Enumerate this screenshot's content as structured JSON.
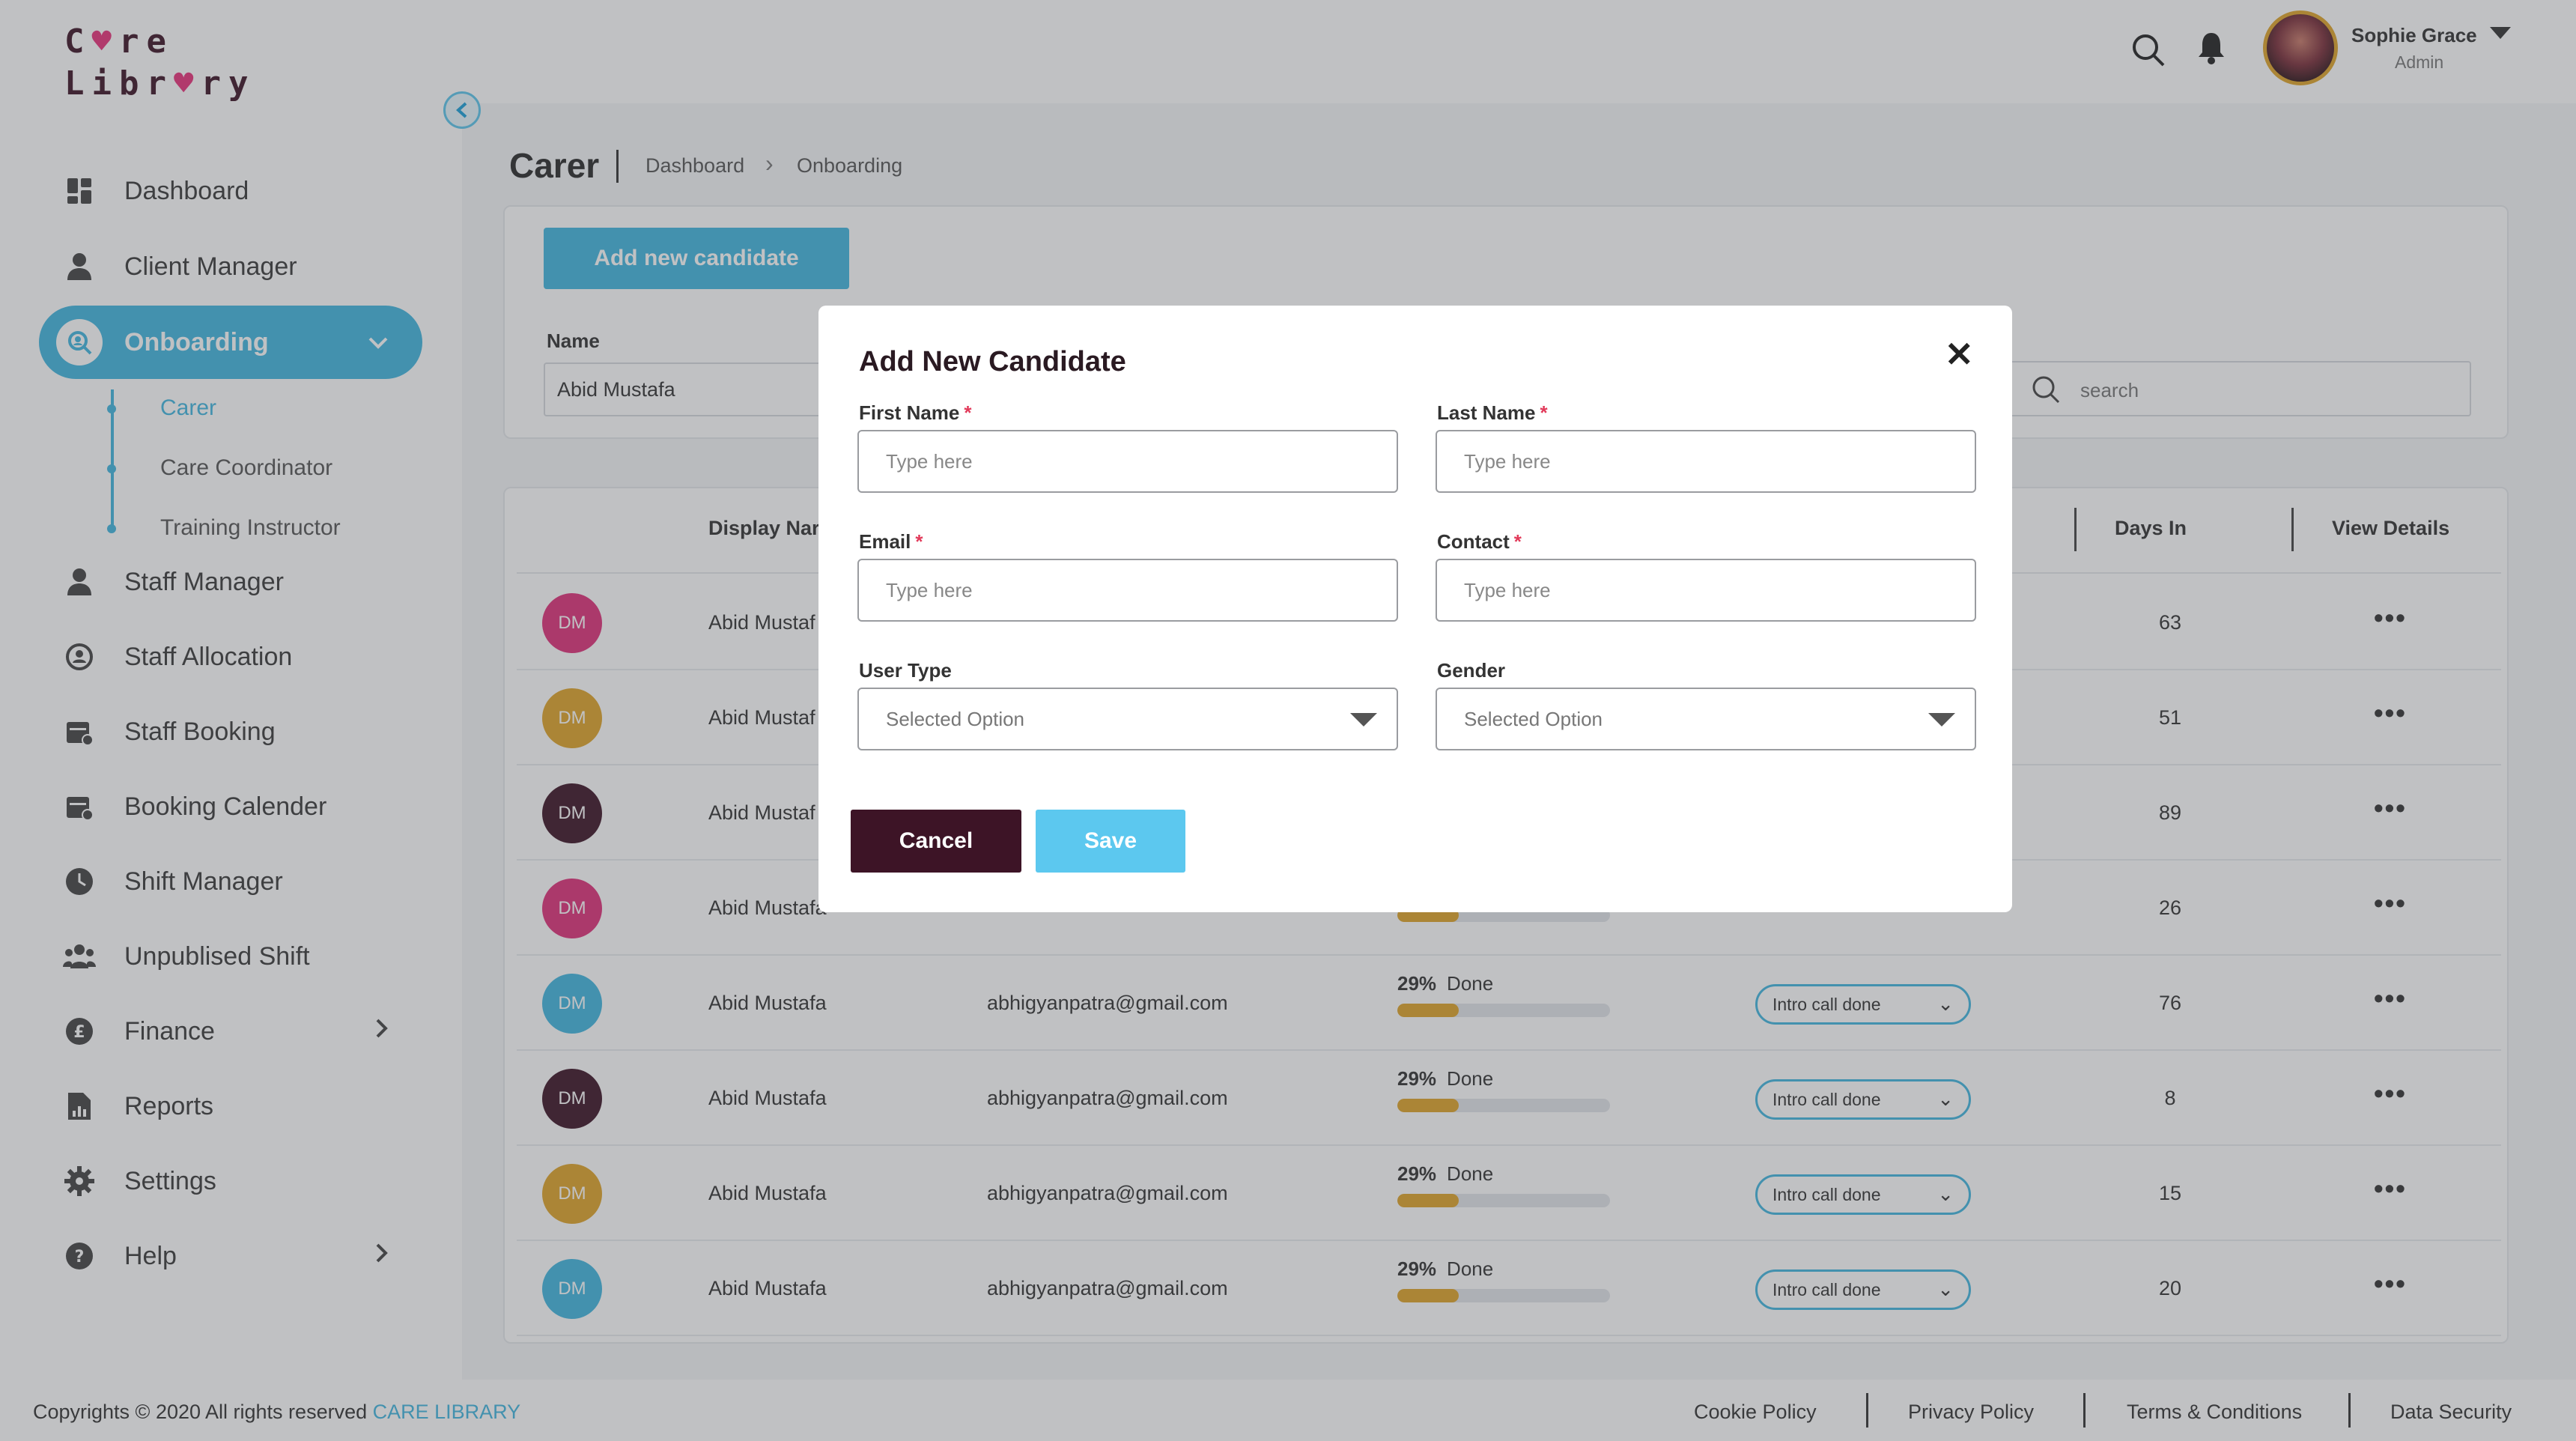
{
  "brand": {
    "logo_line1": "C",
    "logo_line1_rest": "re",
    "logo_line2": "Libr",
    "logo_line2_rest": "ry",
    "heart": "♥"
  },
  "sidebar": {
    "items": [
      {
        "label": "Dashboard",
        "icon": "dashboard-icon"
      },
      {
        "label": "Client Manager",
        "icon": "user-icon"
      },
      {
        "label": "Onboarding",
        "icon": "onboarding-icon"
      },
      {
        "label": "Staff Manager",
        "icon": "user-icon"
      },
      {
        "label": "Staff Allocation",
        "icon": "allocation-icon"
      },
      {
        "label": "Staff Booking",
        "icon": "calendar-icon"
      },
      {
        "label": "Booking Calender",
        "icon": "calendar-icon"
      },
      {
        "label": "Shift Manager",
        "icon": "clock-icon"
      },
      {
        "label": "Unpublised Shift",
        "icon": "group-icon"
      },
      {
        "label": "Finance",
        "icon": "pound-icon"
      },
      {
        "label": "Reports",
        "icon": "report-icon"
      },
      {
        "label": "Settings",
        "icon": "gear-icon"
      },
      {
        "label": "Help",
        "icon": "help-icon"
      }
    ],
    "subitems": [
      "Carer",
      "Care Coordinator",
      "Training Instructor"
    ]
  },
  "header": {
    "user_name": "Sophie Grace",
    "user_role": "Admin"
  },
  "page": {
    "title": "Carer",
    "breadcrumb": [
      "Dashboard",
      "Onboarding"
    ],
    "add_button": "Add new candidate",
    "filter_label": "Name",
    "filter_value": "Abid Mustafa",
    "search_placeholder": "search"
  },
  "table": {
    "headers": {
      "display_name": "Display Nar",
      "days_in": "Days In",
      "view_details": "View Details"
    },
    "rows": [
      {
        "initials": "DM",
        "color": "#e0317a",
        "name": "Abid Mustaf",
        "email": "",
        "progress_label": "",
        "done": "",
        "progress": 0,
        "status": "",
        "days": "63"
      },
      {
        "initials": "DM",
        "color": "#e0a52a",
        "name": "Abid Mustaf",
        "email": "",
        "progress_label": "",
        "done": "",
        "progress": 0,
        "status": "",
        "days": "51"
      },
      {
        "initials": "DM",
        "color": "#3d1426",
        "name": "Abid Mustaf",
        "email": "",
        "progress_label": "",
        "done": "",
        "progress": 0,
        "status": "",
        "days": "89"
      },
      {
        "initials": "DM",
        "color": "#e0317a",
        "name": "Abid Mustafa",
        "email": "",
        "progress_label": "",
        "done": "",
        "progress": 0.29,
        "status": "",
        "days": "26"
      },
      {
        "initials": "DM",
        "color": "#42b6e0",
        "name": "Abid Mustafa",
        "email": "abhigyanpatra@gmail.com",
        "progress_label": "29%",
        "done": "Done",
        "progress": 0.29,
        "status": "Intro call done",
        "days": "76"
      },
      {
        "initials": "DM",
        "color": "#3d1426",
        "name": "Abid Mustafa",
        "email": "abhigyanpatra@gmail.com",
        "progress_label": "29%",
        "done": "Done",
        "progress": 0.29,
        "status": "Intro call done",
        "days": "8"
      },
      {
        "initials": "DM",
        "color": "#e0a52a",
        "name": "Abid Mustafa",
        "email": "abhigyanpatra@gmail.com",
        "progress_label": "29%",
        "done": "Done",
        "progress": 0.29,
        "status": "Intro call done",
        "days": "15"
      },
      {
        "initials": "DM",
        "color": "#42b6e0",
        "name": "Abid Mustafa",
        "email": "abhigyanpatra@gmail.com",
        "progress_label": "29%",
        "done": "Done",
        "progress": 0.29,
        "status": "Intro call done",
        "days": "20"
      }
    ]
  },
  "modal": {
    "title": "Add New Candidate",
    "close": "✕",
    "fields": {
      "first_name": {
        "label": "First Name",
        "placeholder": "Type here"
      },
      "last_name": {
        "label": "Last Name",
        "placeholder": "Type here"
      },
      "email": {
        "label": "Email",
        "placeholder": "Type here"
      },
      "contact": {
        "label": "Contact",
        "placeholder": "Type here"
      },
      "user_type": {
        "label": "User Type",
        "value": "Selected Option"
      },
      "gender": {
        "label": "Gender",
        "value": "Selected Option"
      }
    },
    "required_mark": "*",
    "cancel": "Cancel",
    "save": "Save"
  },
  "footer": {
    "copyright": "Copyrights © 2020  All rights reserved",
    "brand": "CARE LIBRARY",
    "links": [
      "Cookie Policy",
      "Privacy Policy",
      "Terms & Conditions",
      "Data Security"
    ]
  },
  "colors": {
    "accent": "#42b6e0",
    "brand_dark": "#3d1426",
    "pink": "#e0317a",
    "gold": "#e0a52a"
  }
}
